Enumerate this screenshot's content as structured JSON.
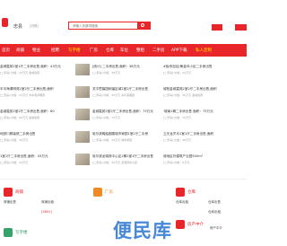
{
  "header": {
    "city": "忠县",
    "city_switch": "[切换]",
    "search_placeholder": "请输入关键词搜索"
  },
  "nav": [
    {
      "label": "首页",
      "highlight": false
    },
    {
      "label": "商铺",
      "highlight": false
    },
    {
      "label": "物业",
      "highlight": false
    },
    {
      "label": "招聘",
      "highlight": false
    },
    {
      "label": "写字楼",
      "highlight": true
    },
    {
      "label": "厂房",
      "highlight": false
    },
    {
      "label": "仓库",
      "highlight": false
    },
    {
      "label": "车位",
      "highlight": false
    },
    {
      "label": "整租",
      "highlight": false
    },
    {
      "label": "二手房",
      "highlight": false
    },
    {
      "label": "APP下载",
      "highlight": false
    },
    {
      "label": "私人定制",
      "highlight": true
    }
  ],
  "listings": [
    {
      "title": "金城嘉苑2室1厅二手房出售,面积：43万元",
      "sub": "[二手房] 价格：43万元 金城嘉苑",
      "col": 0
    },
    {
      "title": "[统计] 二手房出售,面积：38万元",
      "sub": "[二手房] 价格：38万元",
      "col": 1
    },
    {
      "title": "#板块加站/黄金坪小区二手房出售",
      "sub": "[二手房] 价格：22万元",
      "col": 2
    },
    {
      "title": "半中海清明苑2室2厅二手房出售,面积",
      "sub": "[二手房] 价格：52万元 半中海清明苑",
      "col": 0
    },
    {
      "title": "关平思馨园和谐区域2室2厅二手房出售",
      "sub": "[二手房] 价格：45万元 关平思馨园",
      "col": 1
    },
    {
      "title": "城阳金城嘉苑2室2厅二手房出售,面积",
      "sub": "[二手房] 价格：40万元 金城嘉苑",
      "col": 2
    },
    {
      "title": "金城嘉苑2室2厅二手房出售,面积：60",
      "sub": "[二手房] 价格：60万元 金城嘉苑",
      "col": 0
    },
    {
      "title": "金城嘉苑2室2厅二手房出售,面积：75万元",
      "sub": "[二手房] 价格：75万元",
      "col": 1
    },
    {
      "title": "'城南1期二手房出售 面积：75万元",
      "sub": "[二手房] 价格：75万元",
      "col": 2
    },
    {
      "title": "地铁口精装修二手房出售",
      "sub": "[二手房] 价格：30万元",
      "col": 0
    },
    {
      "title": "哈尔滨稀缺圈楼城市家园1室1厅二手房",
      "sub": "[二手房] 价格：29万元 城市家园",
      "col": 1
    },
    {
      "title": "立天龙岁月1室1厅二手房出售,面积",
      "sub": "[二手房] 价格：28万元",
      "col": 2
    },
    {
      "title": "1室1厅二手房出售,面积：43万元",
      "sub": "[二手房] 价格：43万元",
      "col": 0
    },
    {
      "title": "哈尔滨龙瑞府中心区2期2室1厅二手房出售",
      "sub": "[二手房] 价格：56万元 龙瑞府中心区",
      "col": 1
    },
    {
      "title": "城地区外建筑产业园500m²",
      "sub": "[二手房] 价格：6万元",
      "col": 2
    }
  ],
  "categories": [
    {
      "label": "商铺",
      "color": "#e8262a"
    },
    {
      "label": "厂房",
      "color": "#f08a24"
    },
    {
      "label": "仓库",
      "color": "#e8262a"
    },
    {
      "label": "写字楼",
      "color": "#36a26b"
    },
    {
      "label": "房产中介",
      "color": "#e8262a"
    }
  ],
  "category_links": [
    "商铺出售",
    "商铺出租",
    "[3891]",
    "仓库出租",
    "仓库出售",
    "房产中介",
    "仓库出租"
  ],
  "watermark": "便民库"
}
